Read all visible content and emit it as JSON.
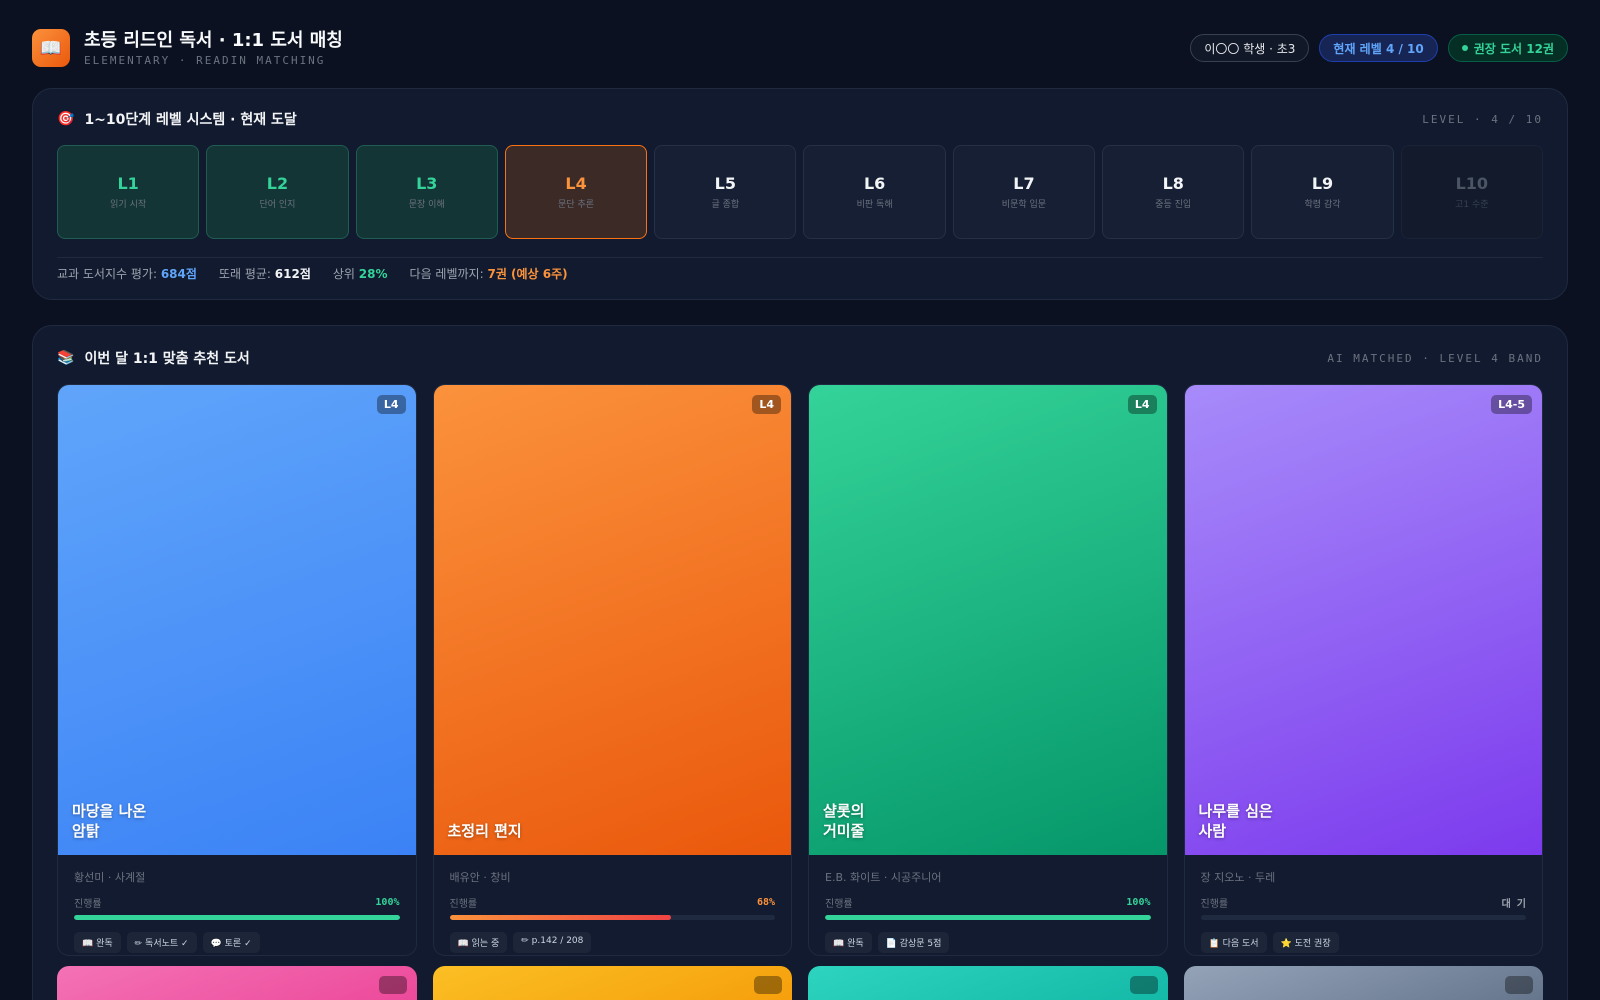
{
  "header": {
    "logo_icon": "book-icon",
    "title": "초등 리드인 독서 · 1:1 도서 매칭",
    "subtitle": "ELEMENTARY · READIN MATCHING",
    "student": "이〇〇 학생 · 초3",
    "current_level": "현재 레벨 4 / 10",
    "recommended": "권장 도서 12권"
  },
  "levels_panel": {
    "icon": "target-icon",
    "title": "1~10단계 레벨 시스템 · 현재 도달",
    "tag": "LEVEL · 4 / 10",
    "levels": [
      {
        "code": "L1",
        "name": "읽기 시작",
        "state": "done"
      },
      {
        "code": "L2",
        "name": "단어 인지",
        "state": "done"
      },
      {
        "code": "L3",
        "name": "문장 이해",
        "state": "done"
      },
      {
        "code": "L4",
        "name": "문단 추론",
        "state": "current"
      },
      {
        "code": "L5",
        "name": "글 종합",
        "state": "open"
      },
      {
        "code": "L6",
        "name": "비판 독해",
        "state": "open"
      },
      {
        "code": "L7",
        "name": "비문학 입문",
        "state": "open"
      },
      {
        "code": "L8",
        "name": "중등 진입",
        "state": "open"
      },
      {
        "code": "L9",
        "name": "학령 감각",
        "state": "open"
      },
      {
        "code": "L10",
        "name": "고1 수준",
        "state": "locked"
      }
    ],
    "stats": {
      "score_label": "교과 도서지수 평가:",
      "score_value": "684점",
      "avg_label": "또래 평균:",
      "avg_value": "612점",
      "rank_label": "상위",
      "rank_value": "28%",
      "next_label": "다음 레벨까지:",
      "next_value": "7권 (예상 6주)"
    }
  },
  "books_panel": {
    "icon": "books-icon",
    "title": "이번 달 1:1 맞춤 추천 도서",
    "tag": "AI MATCHED · LEVEL 4 BAND",
    "progress_label": "진행률",
    "books": [
      {
        "title": "마당을 나온\n암탉",
        "badge": "L4",
        "author": "황선미 · 사계절",
        "progress": 100,
        "progress_text": "100%",
        "gradient": [
          "#60a5fa",
          "#3b82f6"
        ],
        "fill_colors": [
          "#34d399",
          "#34d399"
        ],
        "pct_color": "#34d399",
        "chips": [
          "📖 완독",
          "✏ 독서노트 ✓",
          "💬 토론 ✓"
        ]
      },
      {
        "title": "초정리 편지",
        "badge": "L4",
        "author": "배유안 · 창비",
        "progress": 68,
        "progress_text": "68%",
        "gradient": [
          "#fb923c",
          "#ea580c"
        ],
        "fill_colors": [
          "#fb923c",
          "#ef4444"
        ],
        "pct_color": "#fb923c",
        "chips": [
          "📖 읽는 중",
          "✏ p.142 / 208"
        ]
      },
      {
        "title": "샬롯의\n거미줄",
        "badge": "L4",
        "author": "E.B. 화이트 · 시공주니어",
        "progress": 100,
        "progress_text": "100%",
        "gradient": [
          "#34d399",
          "#059669"
        ],
        "fill_colors": [
          "#34d399",
          "#34d399"
        ],
        "pct_color": "#34d399",
        "chips": [
          "📖 완독",
          "📄 감상문 5점"
        ]
      },
      {
        "title": "나무를 심은\n사람",
        "badge": "L4-5",
        "author": "장 지오노 · 두레",
        "progress": 0,
        "progress_text": "대 기",
        "gradient": [
          "#a78bfa",
          "#7c3aed"
        ],
        "fill_colors": [
          "#1f2a40",
          "#1f2a40"
        ],
        "pct_color": "#9ca3af",
        "chips": [
          "📋 다음 도서",
          "⭐ 도전 권장"
        ]
      }
    ],
    "next_row_colors": [
      [
        "#f472b6",
        "#ec4899"
      ],
      [
        "#fbbf24",
        "#f59e0b"
      ],
      [
        "#2dd4bf",
        "#14b8a6"
      ],
      [
        "#94a3b8",
        "#64748b"
      ]
    ]
  }
}
